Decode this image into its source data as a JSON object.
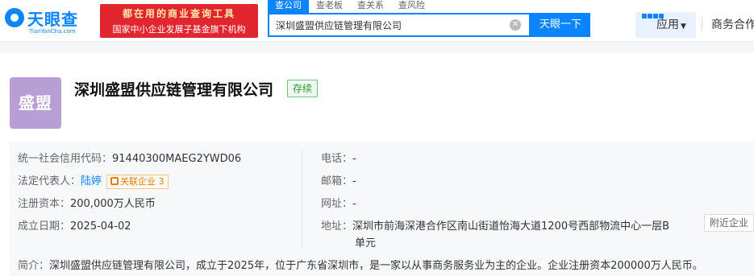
{
  "header": {
    "logo_text": "天眼查",
    "logo_sub": "TianYanCha.com",
    "promo_line1": "都在用的商业查询工具",
    "promo_line2": "国家中小企业发展子基金旗下机构",
    "tabs": [
      "查公司",
      "查老板",
      "查关系",
      "查风险"
    ],
    "search_value": "深圳盛盟供应链管理有限公司",
    "search_button": "天眼一下",
    "apps_label": "应用",
    "biz_coop": "商务合作"
  },
  "company": {
    "logo_text": "盛盟",
    "name": "深圳盛盟供应链管理有限公司",
    "status": "存续"
  },
  "info": {
    "credit_code_label": "统一社会信用代码：",
    "credit_code": "91440300MAEG2YWD06",
    "legal_rep_label": "法定代表人：",
    "legal_rep": "陆婷",
    "related_label": "关联企业",
    "related_count": "3",
    "capital_label": "注册资本：",
    "capital": "200,000万人民币",
    "founded_label": "成立日期：",
    "founded": "2025-04-02",
    "phone_label": "电话：",
    "phone": "-",
    "email_label": "邮箱：",
    "email": "-",
    "website_label": "网址：",
    "website": "-",
    "address_label": "地址：",
    "address_line1": "深圳市前海深港合作区南山街道怡海大道1200号西部物流中心一层B",
    "address_line2": "单元",
    "nearby_button": "附近企业",
    "summary_label": "简介：",
    "summary": "深圳盛盟供应链管理有限公司，成立于2025年，位于广东省深圳市，是一家以从事商务服务业为主的企业。企业注册资本200000万人民币。"
  },
  "colors": {
    "brand": "#0a84ff",
    "promo": "#e2262f",
    "status": "#2a9c3e",
    "related": "#f07a00",
    "company_logo": "#b79fd6"
  }
}
